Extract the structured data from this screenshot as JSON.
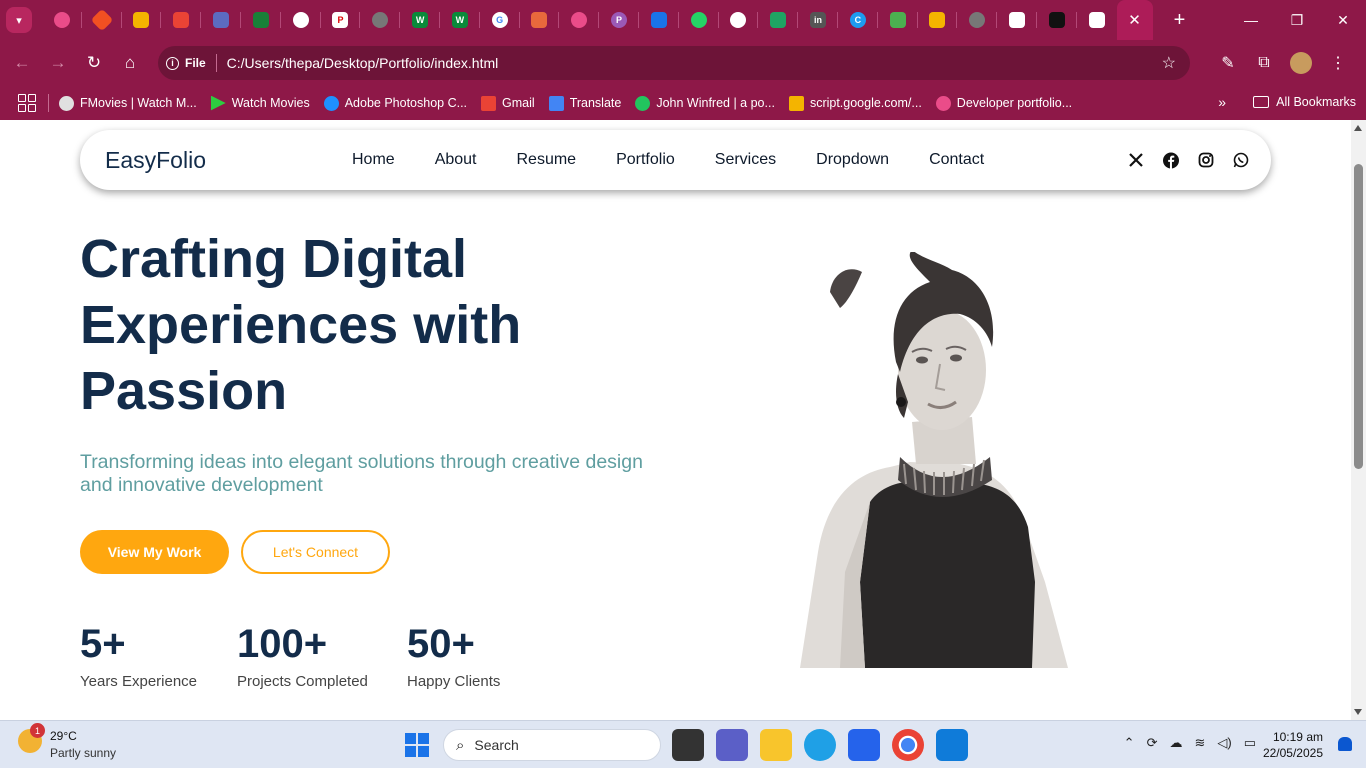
{
  "browser": {
    "tabs_count": 28,
    "active_tab_close": "✕",
    "new_tab": "+",
    "window_controls": {
      "minimize": "—",
      "maximize": "❐",
      "close": "✕"
    },
    "omnibox": {
      "security_label": "File",
      "url": "C:/Users/thepa/Desktop/Portfolio/index.html"
    },
    "bookmarks": [
      {
        "label": "FMovies | Watch M...",
        "color": "#e0e0e0"
      },
      {
        "label": "Watch Movies",
        "color": "#2ecc40"
      },
      {
        "label": "Adobe Photoshop C...",
        "color": "#1e90ff"
      },
      {
        "label": "Gmail",
        "color": "#ea4335"
      },
      {
        "label": "Translate",
        "color": "#4285f4"
      },
      {
        "label": "John Winfred | a po...",
        "color": "#22c55e"
      },
      {
        "label": "script.google.com/...",
        "color": "#f4b400"
      },
      {
        "label": "Developer portfolio...",
        "color": "#ea4c89"
      }
    ],
    "bookmarks_more": "»",
    "all_bookmarks": "All Bookmarks"
  },
  "site": {
    "logo": "EasyFolio",
    "menu": [
      "Home",
      "About",
      "Resume",
      "Portfolio",
      "Services",
      "Dropdown",
      "Contact"
    ],
    "social": [
      "x-icon",
      "facebook-icon",
      "instagram-icon",
      "whatsapp-icon"
    ],
    "hero": {
      "title": "Crafting Digital Experiences with Passion",
      "subtitle": "Transforming ideas into elegant solutions through creative design and innovative development",
      "primary_button": "View My Work",
      "secondary_button": "Let's Connect"
    },
    "stats": [
      {
        "number": "5+",
        "label": "Years Experience"
      },
      {
        "number": "100+",
        "label": "Projects Completed"
      },
      {
        "number": "50+",
        "label": "Happy Clients"
      }
    ],
    "colors": {
      "accent": "#ffa70f",
      "heading": "#132c4a",
      "subtitle": "#5f9ea0"
    }
  },
  "taskbar": {
    "weather": {
      "temp": "29°C",
      "condition": "Partly sunny",
      "badge": "1"
    },
    "search_placeholder": "Search",
    "clock": {
      "time": "10:19 am",
      "date": "22/05/2025"
    }
  }
}
